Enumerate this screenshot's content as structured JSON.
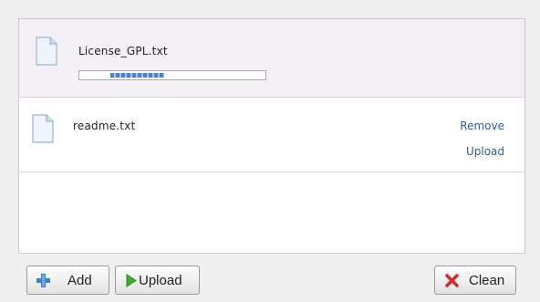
{
  "files": [
    {
      "name": "License_GPL.txt",
      "icon": "document-icon",
      "status": "uploading",
      "progress": 0.3
    },
    {
      "name": "readme.txt",
      "icon": "document-icon",
      "status": "queued",
      "actions": {
        "remove": "Remove",
        "upload": "Upload"
      }
    }
  ],
  "buttons": {
    "add": {
      "label": "Add",
      "icon": "plus-icon"
    },
    "upload": {
      "label": "Upload",
      "icon": "play-arrow-icon"
    },
    "clean": {
      "label": "Clean",
      "icon": "red-x-icon"
    }
  },
  "colors": {
    "link": "#2d5d99",
    "progress": "#4a83c9",
    "add_icon": "#3a7fd0",
    "upload_icon": "#3fb02a",
    "clean_icon": "#d42a2a"
  }
}
